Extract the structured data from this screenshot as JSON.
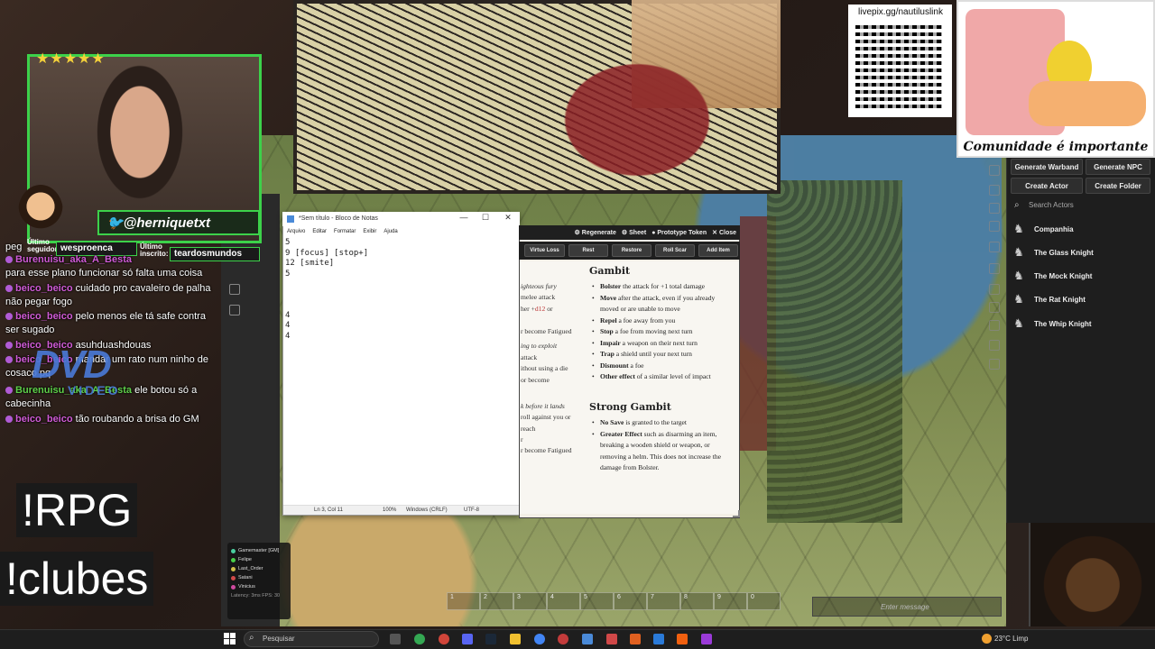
{
  "overlay": {
    "twitter_handle": "@herniquetxt",
    "last_follower_label": "Último seguidor:",
    "last_follower_name": "wesproenca",
    "last_sub_label": "Último inscrito:",
    "last_sub_name": "teardosmundos",
    "qr_url": "livepix.gg/nautiluslink",
    "pixel_caption": "Comunidade é importante",
    "dvd_logo": "DVD",
    "dvd_video": "VIDEO",
    "commands": [
      "!RPG",
      "!clubes"
    ],
    "stars": "★★★★★"
  },
  "chat": [
    {
      "user": "",
      "text": "peg"
    },
    {
      "user": "Burenuisu_aka_A_Besta",
      "text": "para esse plano funcionar só falta uma coisa"
    },
    {
      "user": "beico_beico",
      "text": "cuidado pro cavaleiro de palha não pegar fogo"
    },
    {
      "user": "beico_beico",
      "text": "pelo menos ele tá safe contra ser sugado"
    },
    {
      "user": "beico_beico",
      "text": "asuhduashdouas"
    },
    {
      "user": "beico_beico",
      "text": "mandar um rato num ninho de cosaco pq"
    },
    {
      "user": "Burenuisu_aka_A_Besta",
      "text": "ele botou só a cabecinha"
    },
    {
      "user": "beico_beico",
      "text": "tão roubando a brisa do GM"
    }
  ],
  "notepad": {
    "title": "*Sem título - Bloco de Notas",
    "menu": [
      "Arquivo",
      "Editar",
      "Formatar",
      "Exibir",
      "Ajuda"
    ],
    "content": "5\n9 [focus] [stop+]\n12 [smite]\n5\n\n\n\n4\n4\n4",
    "status_pos": "Ln 3, Col 11",
    "status_zoom": "100%",
    "status_eol": "Windows (CRLF)",
    "status_enc": "UTF-8",
    "min": "—",
    "max": "☐",
    "close": "✕"
  },
  "sheet": {
    "header_buttons": [
      "Regenerate",
      "Sheet",
      "Prototype Token",
      "Close"
    ],
    "tabs": [
      "Virtue Loss",
      "Rest",
      "Restore",
      "Roll Scar",
      "Add Item"
    ],
    "left_fragments": [
      "ighteous fury",
      "melee attack",
      "her +",
      "d12",
      "or",
      "r become Fatigued",
      "ing to exploit",
      "attack",
      "ithout using a die",
      "or become",
      "k before it lands",
      "roll against you or",
      "reach",
      "r",
      "r become Fatigued"
    ],
    "gambit_title": "Gambit",
    "gambit_items": [
      {
        "bold": "Bolster",
        "text": " the attack for +1 total damage"
      },
      {
        "bold": "Move",
        "text": " after the attack, even if you already moved or are unable to move"
      },
      {
        "bold": "Repel",
        "text": " a foe away from you"
      },
      {
        "bold": "Stop",
        "text": " a foe from moving next turn"
      },
      {
        "bold": "Impair",
        "text": " a weapon on their next turn"
      },
      {
        "bold": "Trap",
        "text": " a shield until your next turn"
      },
      {
        "bold": "Dismount",
        "text": " a foe"
      },
      {
        "bold": "Other effect",
        "text": " of a similar level of impact"
      }
    ],
    "strong_title": "Strong Gambit",
    "strong_items": [
      {
        "bold": "No Save",
        "text": " is granted to the target"
      },
      {
        "bold": "Greater Effect",
        "text": " such as disarming an item, breaking a wooden shield or weapon, or removing a helm. This does not increase the damage from Bolster."
      }
    ]
  },
  "vtt": {
    "buttons": [
      "Generate Warband",
      "Generate NPC",
      "Create Actor",
      "Create Folder"
    ],
    "search_placeholder": "Search Actors",
    "actors": [
      "Companhia",
      "The Glass Knight",
      "The Mock Knight",
      "The Rat Knight",
      "The Whip Knight"
    ],
    "players": [
      {
        "name": "Gamemaster [GM]",
        "color": "#4ad0a0"
      },
      {
        "name": "Felipe",
        "color": "#4ad04a"
      },
      {
        "name": "Last_Order",
        "color": "#d0c04a"
      },
      {
        "name": "Satani",
        "color": "#d04a4a"
      },
      {
        "name": "Vinicius",
        "color": "#d04aa0"
      }
    ],
    "latency": "Latency: 3ms  FPS: 30",
    "hotbar": [
      "1",
      "2",
      "3",
      "4",
      "5",
      "6",
      "7",
      "8",
      "9",
      "0"
    ],
    "chat_placeholder": "Enter message"
  },
  "taskbar": {
    "search_placeholder": "Pesquisar",
    "weather": "23°C  Limp"
  }
}
